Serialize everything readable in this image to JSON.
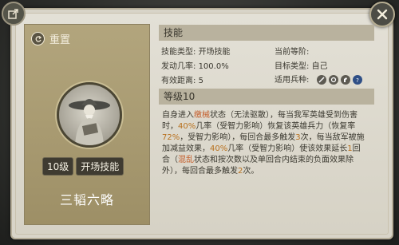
{
  "left": {
    "reset_label": "重置",
    "level_badge": "10级",
    "type_badge": "开场技能",
    "skill_name": "三韬六略"
  },
  "info": {
    "section_title": "技能",
    "skill_type_label": "技能类型:",
    "skill_type_value": "开场技能",
    "trigger_rate_label": "发动几率:",
    "trigger_rate_value": "100.0%",
    "range_label": "有效距离:",
    "range_value": "5",
    "current_stage_label": "当前等阶:",
    "current_stage_value": "",
    "target_label": "目标类型:",
    "target_value": "自己",
    "troop_label": "适用兵种:",
    "troop_icons": [
      "sword-icon",
      "shield-icon",
      "horse-icon",
      "question-icon"
    ]
  },
  "level": {
    "section_title": "等级10",
    "t1": "自身进入",
    "t2": "缴械",
    "t3": "状态（无法驱散），每当我军英雄受到伤害时，",
    "t4": "40%",
    "t5": "几率（受智力影响）恢复该英雄兵力（恢复率",
    "t6": "72%",
    "t7": "，受智力影响），每回合最多触发",
    "t8": "3",
    "t9": "次，每当敌军被施加减益效果，",
    "t10": "40%",
    "t11": "几率（受智力影响）使该效果延长",
    "t12": "1",
    "t13": "回合（",
    "t14": "混乱",
    "t15": "状态和按次数以及单回合内结束的负面效果除外），每回合最多触发",
    "t16": "2",
    "t17": "次。"
  },
  "colors": {
    "highlight": "#b8711e",
    "status_tag": "#c45d2a"
  }
}
